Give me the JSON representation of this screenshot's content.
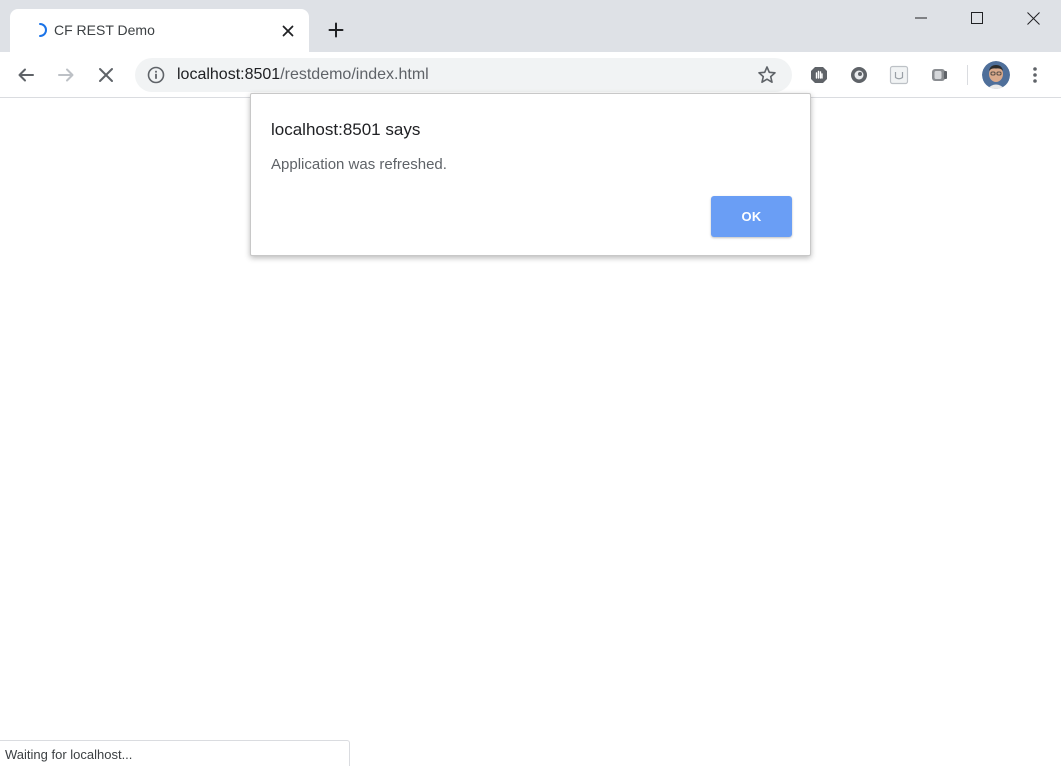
{
  "browser": {
    "tab": {
      "title": "CF REST Demo",
      "icon": "loading-spinner-icon",
      "close_icon": "close-icon"
    },
    "new_tab_icon": "plus-icon",
    "window_controls": [
      "minimize-icon",
      "maximize-icon",
      "close-icon"
    ],
    "address_bar": {
      "host": "localhost:8501",
      "path": "/restdemo/index.html",
      "info_icon": "info-icon",
      "bookmark_icon": "star-icon"
    },
    "nav_icons": [
      "back-arrow-icon",
      "forward-arrow-icon",
      "stop-icon"
    ],
    "extensions": [
      "shield-extension-icon",
      "circle-extension-icon",
      "square-extension-icon",
      "reel-extension-icon"
    ],
    "menu_icon": "kebab-menu-icon"
  },
  "dialog": {
    "title": "localhost:8501 says",
    "message": "Application was refreshed.",
    "ok_label": "OK"
  },
  "status": {
    "text": "Waiting for localhost..."
  },
  "colors": {
    "tabstrip": "#dee1e6",
    "omnibox": "#f1f3f4",
    "ok_button": "#6a9ef5",
    "spinner": "#1a73e8"
  }
}
